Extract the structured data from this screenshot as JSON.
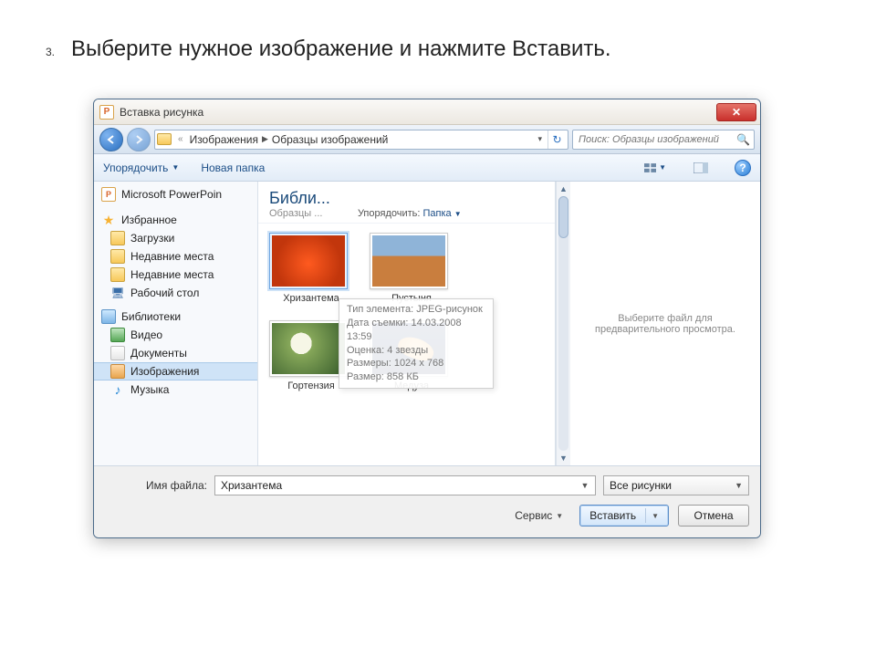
{
  "instruction": {
    "number": "3.",
    "text": "Выберите нужное изображение и нажмите Вставить."
  },
  "window_title": "Вставка рисунка",
  "breadcrumbs": [
    "Изображения",
    "Образцы изображений"
  ],
  "search": {
    "placeholder": "Поиск: Образцы изображений"
  },
  "toolbar": {
    "organize": "Упорядочить",
    "new_folder": "Новая папка"
  },
  "sidebar": {
    "top": "Microsoft PowerPoin",
    "fav": "Избранное",
    "fav_items": [
      "Загрузки",
      "Недавние места",
      "Недавние места",
      "Рабочий стол"
    ],
    "lib": "Библиотеки",
    "lib_items": [
      "Видео",
      "Документы",
      "Изображения",
      "Музыка"
    ],
    "lib_selected_index": 2
  },
  "library_header": {
    "title": "Библи...",
    "subtitle": "Образцы ...",
    "sort_label": "Упорядочить:",
    "sort_value": "Папка"
  },
  "thumbnails": [
    {
      "label": "Хризантема",
      "selected": true,
      "klass": "pi-orange"
    },
    {
      "label": "Пустыня",
      "selected": false,
      "klass": "pi-desert"
    },
    {
      "label": "Гортензия",
      "selected": false,
      "klass": "pi-flower"
    },
    {
      "label": "Медуза",
      "selected": false,
      "klass": "pi-jelly"
    }
  ],
  "tooltip": {
    "l1": "Тип элемента: JPEG-рисунок",
    "l2": "Дата съемки: 14.03.2008 13:59",
    "l3": "Оценка: 4 звезды",
    "l4": "Размеры: 1024 x 768",
    "l5": "Размер: 858 КБ"
  },
  "preview_hint": "Выберите файл для предварительного просмотра.",
  "bottom": {
    "filename_label": "Имя файла:",
    "filename_value": "Хризантема",
    "filter": "Все рисунки",
    "service": "Сервис",
    "insert": "Вставить",
    "cancel": "Отмена"
  }
}
